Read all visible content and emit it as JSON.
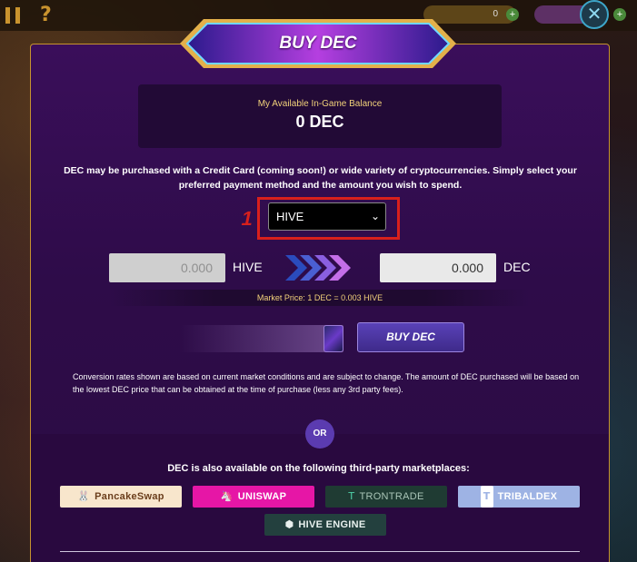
{
  "topbar": {
    "pause_icon": "pause-icon",
    "help_icon": "help-icon",
    "help_glyph": "?",
    "balance_value": "0",
    "close_glyph": "✕"
  },
  "modal": {
    "title": "BUY DEC",
    "balance_label": "My Available In-Game Balance",
    "balance_value": "0 DEC",
    "description": "DEC may be purchased with a Credit Card (coming soon!) or wide variety of cryptocurrencies. Simply select your preferred payment method and the amount you wish to spend.",
    "step_number": "1",
    "payment_method": {
      "selected": "HIVE"
    },
    "from_amount": "0.000",
    "from_unit": "HIVE",
    "to_amount": "0.000",
    "to_unit": "DEC",
    "market_price": "Market Price: 1 DEC = 0.003 HIVE",
    "buy_button": "BUY DEC",
    "conversion_note": "Conversion rates shown are based on current market conditions and are subject to change. The amount of DEC purchased will be based on the lowest DEC price that can be obtained at the time of purchase (less any 3rd party fees).",
    "or_label": "OR",
    "also_available": "DEC is also available on the following third-party marketplaces:",
    "marketplaces": [
      {
        "label": "PancakeSwap",
        "icon": "pancakeswap-icon"
      },
      {
        "label": "UNISWAP",
        "icon": "uniswap-icon"
      },
      {
        "label": "TRONTRADE",
        "icon": "trontrade-icon"
      },
      {
        "label": "TRIBALDEX",
        "icon": "tribaldex-icon"
      },
      {
        "label": "HIVE ENGINE",
        "icon": "hive-engine-icon"
      }
    ]
  },
  "colors": {
    "accent_gold": "#c6932f",
    "modal_purple": "#3a0e5a",
    "highlight_red": "#d8201c",
    "button_violet": "#5a42b8"
  }
}
